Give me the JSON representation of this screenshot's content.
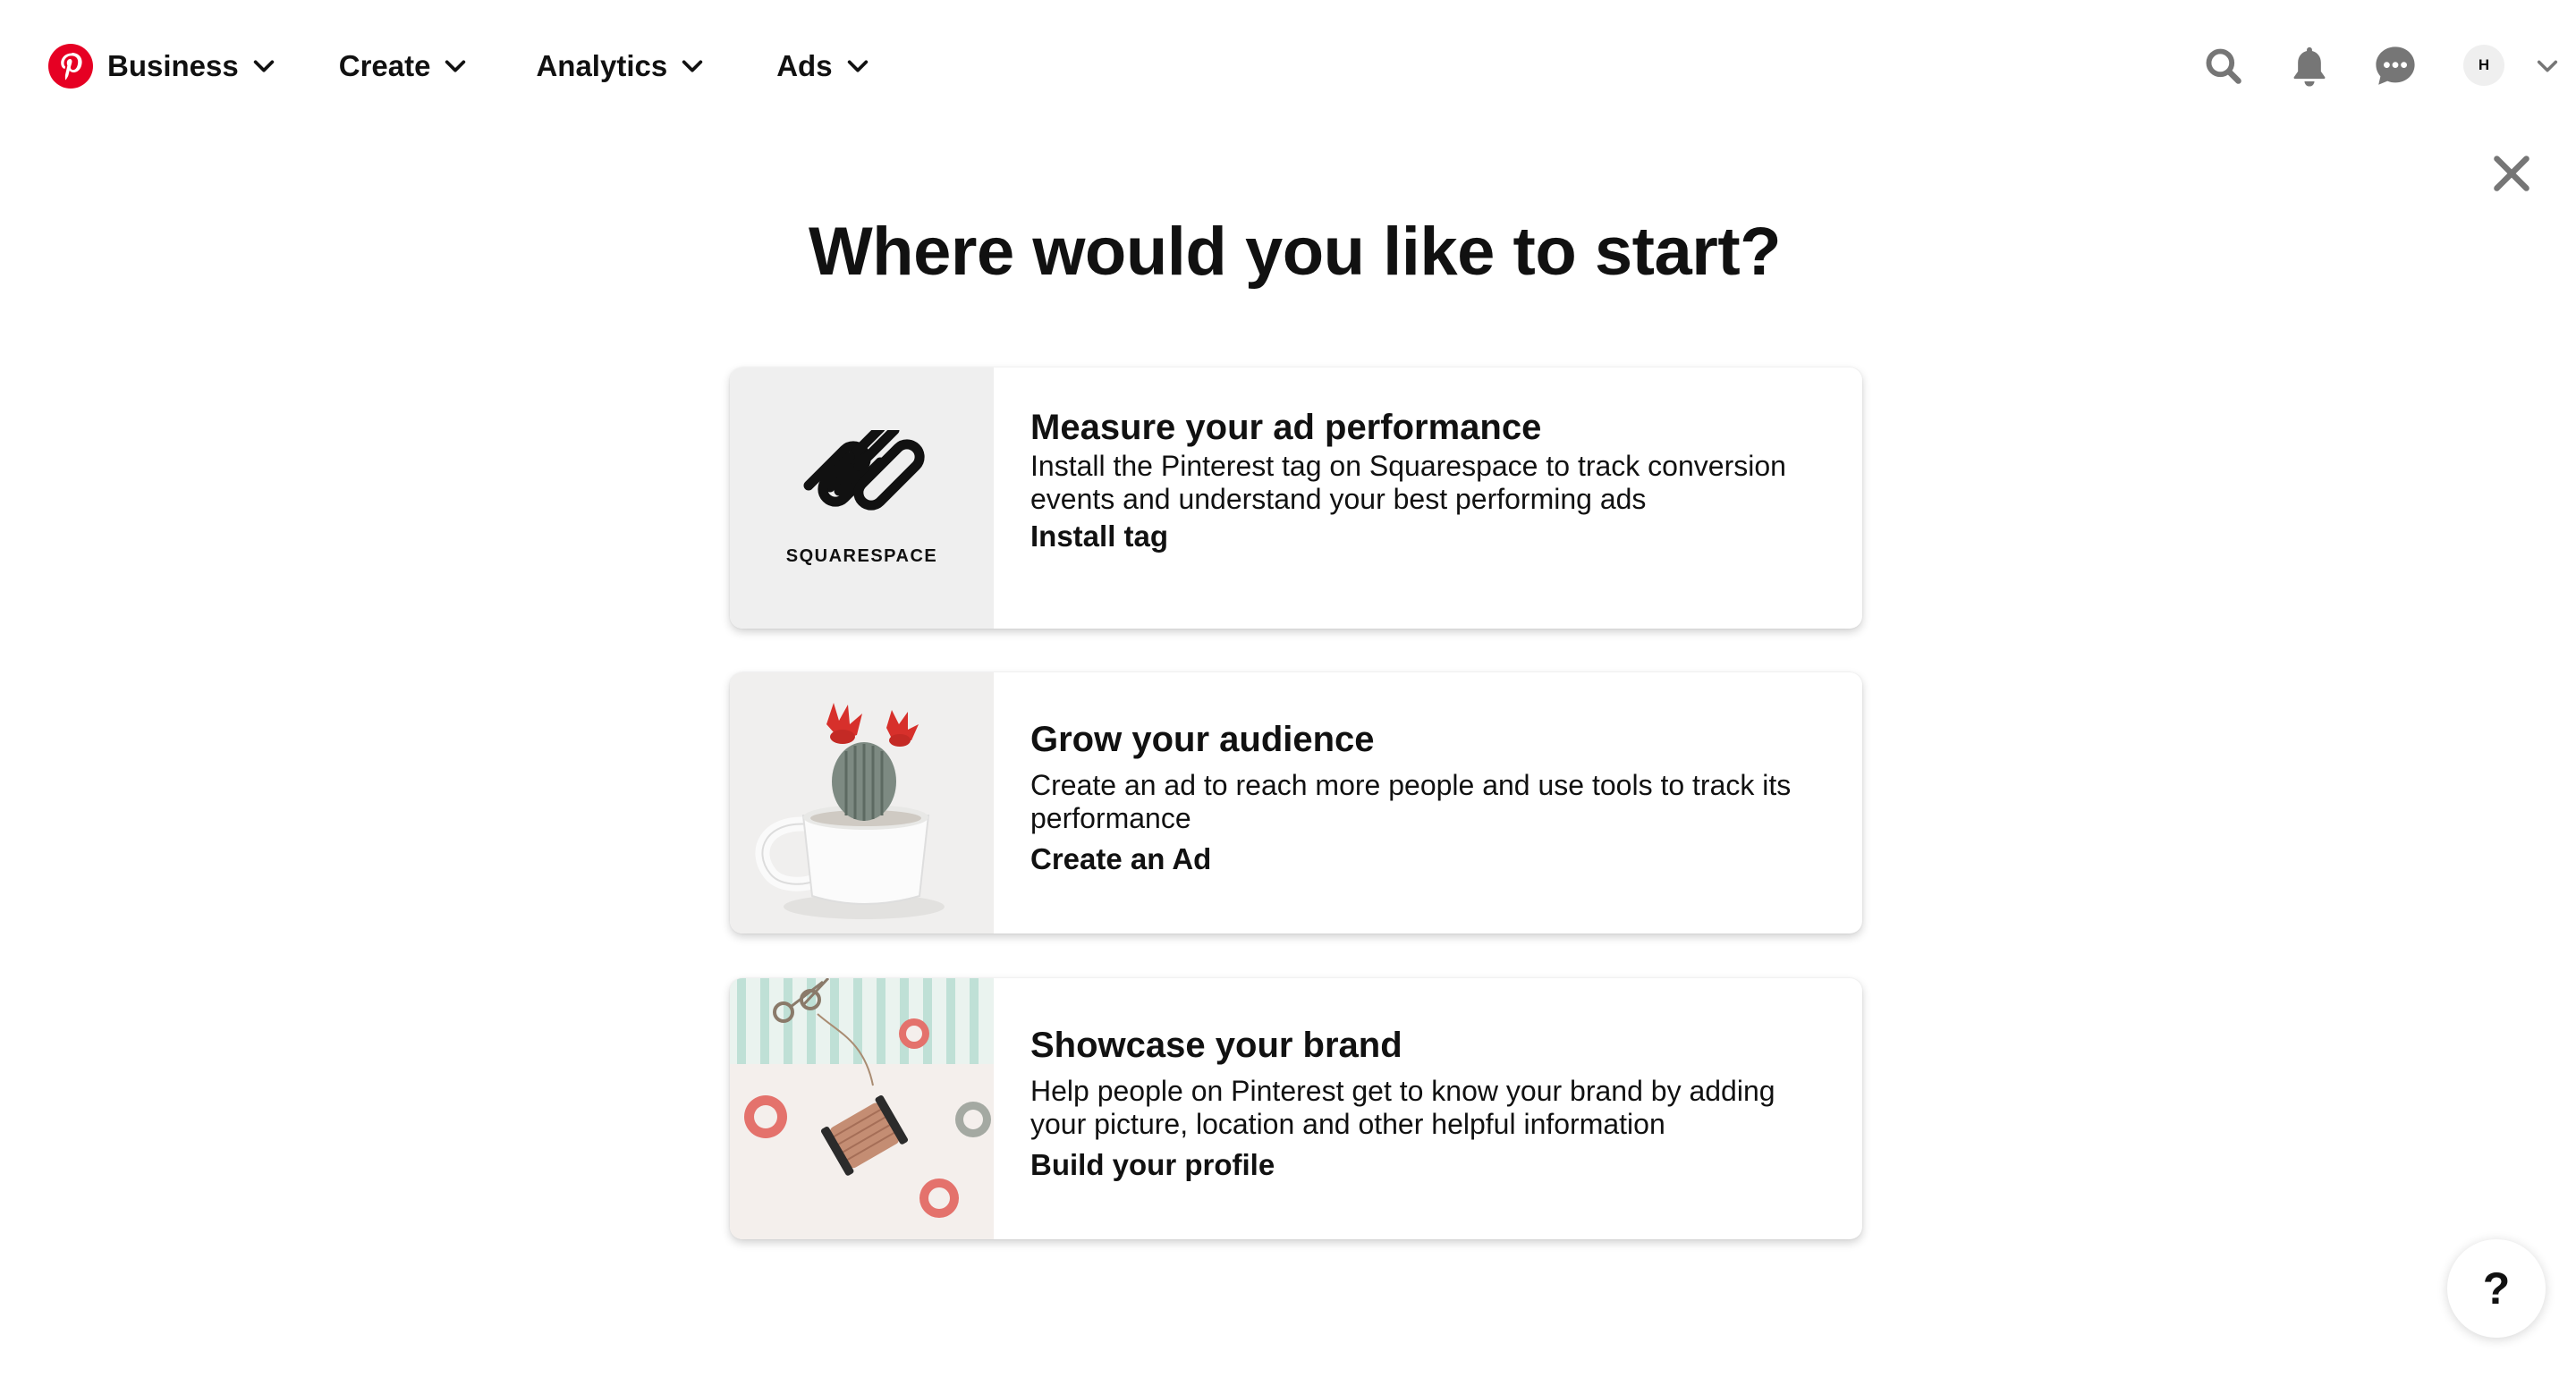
{
  "header": {
    "brand_icon": "pinterest-logo-icon",
    "nav": [
      {
        "label": "Business"
      },
      {
        "label": "Create"
      },
      {
        "label": "Analytics"
      },
      {
        "label": "Ads"
      }
    ],
    "avatar_initial": "H",
    "icons": [
      "search-icon",
      "bell-icon",
      "messages-icon",
      "chevron-down-icon"
    ]
  },
  "modal": {
    "title": "Where would you like to start?",
    "close_icon": "close-icon"
  },
  "cards": [
    {
      "title": "Measure your ad performance",
      "description": "Install the Pinterest tag on Squarespace to track conversion events and understand your best performing ads",
      "link": "Install tag",
      "image_caption": "SQUARESPACE"
    },
    {
      "title": "Grow your audience",
      "description": "Create an ad to reach more people and use tools to track its performance",
      "link": "Create an Ad"
    },
    {
      "title": "Showcase your brand",
      "description": "Help people on Pinterest get to know your brand by adding your picture, location and other helpful information",
      "link": "Build your profile"
    }
  ],
  "help_button": "?",
  "colors": {
    "brand": "#e60023",
    "text": "#111111",
    "icon_gray": "#767676",
    "image_bg": "#efefef"
  }
}
